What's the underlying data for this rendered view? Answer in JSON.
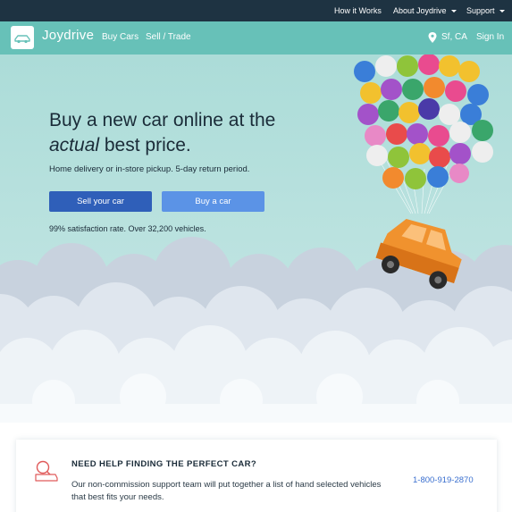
{
  "topbar": {
    "how_it_works": "How it Works",
    "about": "About Joydrive",
    "support": "Support"
  },
  "nav": {
    "brand": "Joydrive",
    "buy_cars": "Buy Cars",
    "sell_trade": "Sell / Trade",
    "location": "Sf, CA",
    "sign_in": "Sign In"
  },
  "hero": {
    "headline_pre": "Buy a new car online at the ",
    "headline_em": "actual",
    "headline_post": " best price.",
    "subline": "Home delivery or in-store pickup. 5-day return period.",
    "sell_button": "Sell your car",
    "buy_button": "Buy a car",
    "stats": "99% satisfaction rate. Over 32,200 vehicles."
  },
  "help_card": {
    "title": "NEED HELP FINDING THE PERFECT CAR?",
    "body": "Our non-commission support team will put together a list of hand selected vehicles that best fits your needs.",
    "phone": "1-800-919-2870"
  },
  "colors": {
    "topbar_bg": "#1e3342",
    "nav_bg": "#67c1b8",
    "hero_bg": "#b6e0de",
    "sell_button": "#2f5fb9",
    "buy_button": "#5b93e6",
    "car": "#f0922e",
    "phone_link": "#3a6fcf",
    "search_icon": "#e05a5a"
  },
  "icons": {
    "logo": "car-logo-icon",
    "about_dropdown": "chevron-down-icon",
    "support_dropdown": "chevron-down-icon",
    "location": "map-pin-icon",
    "help": "car-search-icon"
  }
}
